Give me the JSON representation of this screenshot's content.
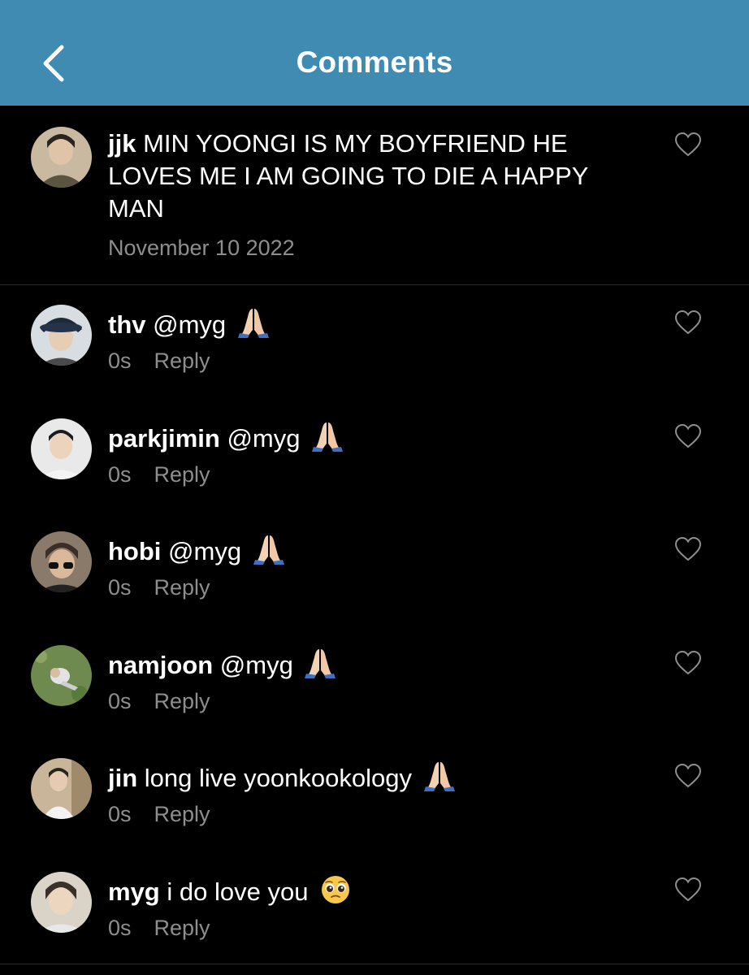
{
  "colors": {
    "header_bg": "#3f8bb1",
    "background": "#000000",
    "meta_text": "#8e8e8e"
  },
  "header": {
    "title": "Comments",
    "back_icon": "chevron-left-icon"
  },
  "caption": {
    "username": "jjk",
    "text": "MIN YOONGI IS MY BOYFRIEND HE LOVES ME I AM GOING TO DIE A HAPPY MAN",
    "date": "November 10 2022"
  },
  "comments": [
    {
      "username": "thv",
      "text": "@myg",
      "emoji": "folded-hands-emoji",
      "time": "0s",
      "reply_label": "Reply"
    },
    {
      "username": "parkjimin",
      "text": "@myg",
      "emoji": "folded-hands-emoji",
      "time": "0s",
      "reply_label": "Reply"
    },
    {
      "username": "hobi",
      "text": "@myg",
      "emoji": "folded-hands-emoji",
      "time": "0s",
      "reply_label": "Reply"
    },
    {
      "username": "namjoon",
      "text": "@myg",
      "emoji": "folded-hands-emoji",
      "time": "0s",
      "reply_label": "Reply"
    },
    {
      "username": "jin",
      "text": "long live yoonkookology",
      "emoji": "folded-hands-emoji",
      "time": "0s",
      "reply_label": "Reply"
    },
    {
      "username": "myg",
      "text": "i do love you",
      "emoji": "pleading-face-emoji",
      "time": "0s",
      "reply_label": "Reply"
    }
  ]
}
